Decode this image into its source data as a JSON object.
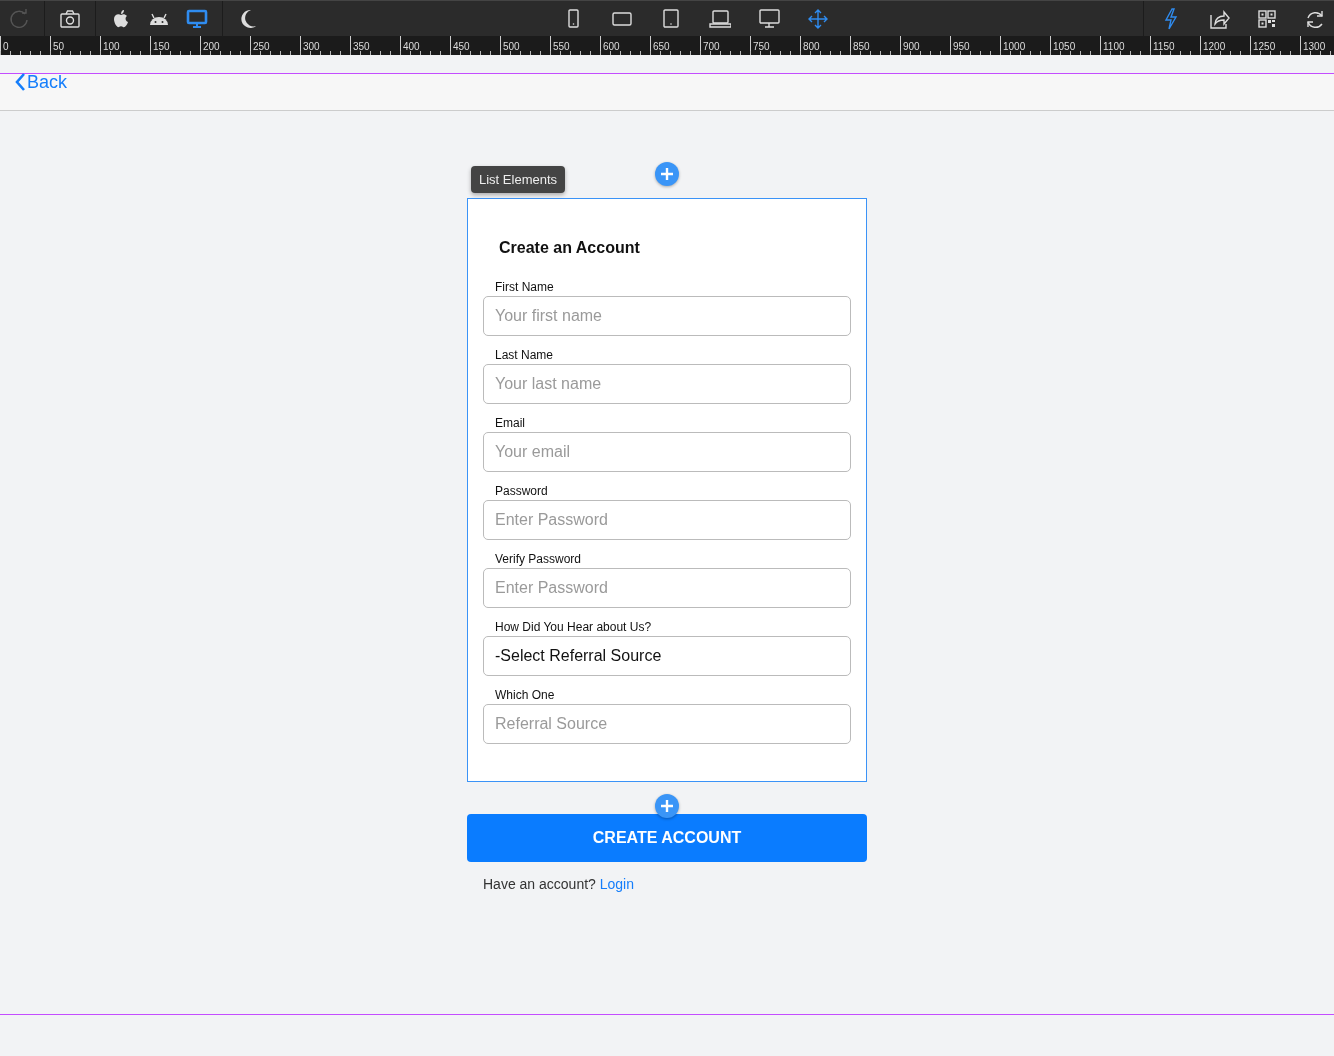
{
  "toolbar": {
    "left_tools": [
      {
        "kind": "redo",
        "disabled": true,
        "selected": false
      },
      {
        "kind": "camera",
        "disabled": false,
        "selected": false
      },
      {
        "kind": "apple",
        "disabled": false,
        "selected": false
      },
      {
        "kind": "android",
        "disabled": false,
        "selected": false
      },
      {
        "kind": "desktop",
        "disabled": false,
        "selected": true
      },
      {
        "kind": "moon",
        "disabled": false,
        "selected": false
      }
    ],
    "devices": [
      {
        "kind": "phone",
        "selected": false
      },
      {
        "kind": "tablet-landscape",
        "selected": false
      },
      {
        "kind": "tablet",
        "selected": false
      },
      {
        "kind": "laptop",
        "selected": false
      },
      {
        "kind": "monitor",
        "selected": false
      },
      {
        "kind": "move",
        "selected": true
      }
    ],
    "right_tools": [
      {
        "kind": "bolt",
        "selected": true
      },
      {
        "kind": "share",
        "selected": false
      },
      {
        "kind": "qr",
        "selected": false
      },
      {
        "kind": "refresh",
        "selected": false
      }
    ]
  },
  "ruler": [
    "0",
    "50",
    "100",
    "150",
    "200",
    "250",
    "300",
    "350",
    "400",
    "450",
    "500",
    "550",
    "600",
    "650",
    "700",
    "750",
    "800",
    "850",
    "900",
    "950",
    "1000",
    "1050",
    "1100",
    "1150",
    "1200",
    "1250",
    "1300"
  ],
  "nav": {
    "back": "Back"
  },
  "list_badge": "List Elements",
  "form": {
    "title": "Create an Account",
    "fields": [
      {
        "kind": "text",
        "label": "First Name",
        "placeholder": "Your first name"
      },
      {
        "kind": "text",
        "label": "Last Name",
        "placeholder": "Your last name"
      },
      {
        "kind": "text",
        "label": "Email",
        "placeholder": "Your email"
      },
      {
        "kind": "text",
        "label": "Password",
        "placeholder": "Enter Password"
      },
      {
        "kind": "text",
        "label": "Verify Password",
        "placeholder": "Enter Password"
      },
      {
        "kind": "select",
        "label": "How Did You Hear about Us?",
        "value": "-Select Referral Source"
      },
      {
        "kind": "text",
        "label": "Which One",
        "placeholder": "Referral Source"
      }
    ]
  },
  "submit": "CREATE ACCOUNT",
  "footer": {
    "text": "Have an account?",
    "link": "Login"
  }
}
